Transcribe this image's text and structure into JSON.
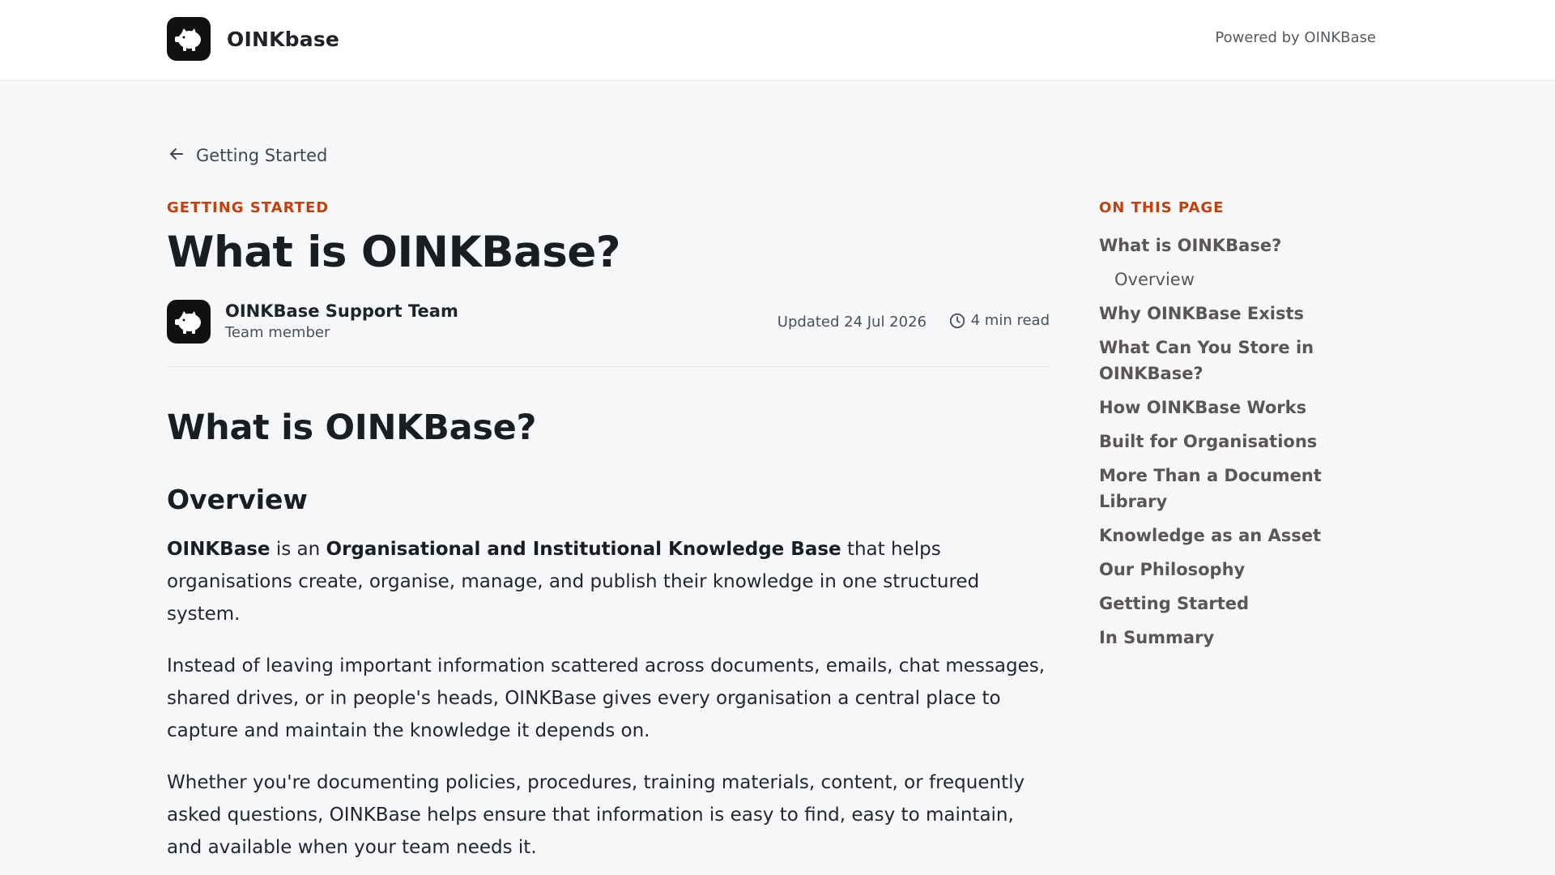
{
  "header": {
    "brand_name": "OINKbase",
    "powered_by": "Powered by OINKBase"
  },
  "back_link": {
    "label": "Getting Started"
  },
  "article": {
    "eyebrow": "GETTING STARTED",
    "title": "What is OINKBase?",
    "author_name": "OINKBase Support Team",
    "author_role": "Team member",
    "updated": "Updated 24 Jul 2026",
    "read_time": "4 min read",
    "h2": "What is OINKBase?",
    "h3": "Overview",
    "p1_bold1": "OINKBase",
    "p1_text1": " is an ",
    "p1_bold2": "Organisational and Institutional Knowledge Base",
    "p1_text2": " that helps organisations create, organise, manage, and publish their knowledge in one structured system.",
    "p2": "Instead of leaving important information scattered across documents, emails, chat messages, shared drives, or in people's heads, OINKBase gives every organisation a central place to capture and maintain the knowledge it depends on.",
    "p3": "Whether you're documenting policies, procedures, training materials, content, or frequently asked questions, OINKBase helps ensure that information is easy to find, easy to maintain, and available when your team needs it."
  },
  "toc": {
    "heading": "ON THIS PAGE",
    "items": [
      {
        "label": "What is OINKBase?"
      },
      {
        "label": "Overview"
      },
      {
        "label": "Why OINKBase Exists"
      },
      {
        "label": "What Can You Store in OINKBase?"
      },
      {
        "label": "How OINKBase Works"
      },
      {
        "label": "Built for Organisations"
      },
      {
        "label": "More Than a Document Library"
      },
      {
        "label": "Knowledge as an Asset"
      },
      {
        "label": "Our Philosophy"
      },
      {
        "label": "Getting Started"
      },
      {
        "label": "In Summary"
      }
    ]
  },
  "icons": {
    "logo": "pig-icon",
    "back": "arrow-left-icon",
    "read_time": "clock-icon"
  },
  "colors": {
    "accent": "#c2410c",
    "toc_text": "#5b5553",
    "background": "#f6f7f9"
  }
}
